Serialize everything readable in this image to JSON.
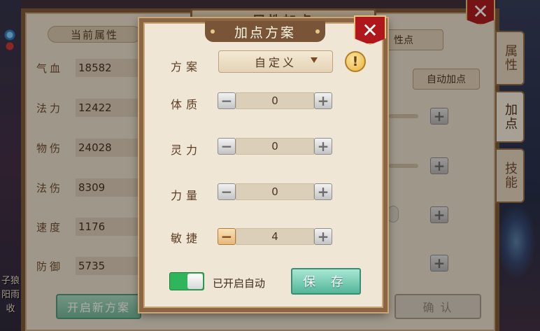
{
  "back_panel": {
    "title": "属性加点",
    "current_attr_tab": "当前属性",
    "attributes": [
      {
        "name": "气血",
        "value": "18582"
      },
      {
        "name": "法力",
        "value": "12422"
      },
      {
        "name": "物伤",
        "value": "24028"
      },
      {
        "name": "法伤",
        "value": "8309"
      },
      {
        "name": "速度",
        "value": "1176"
      },
      {
        "name": "防御",
        "value": "5735"
      }
    ],
    "partial_button": "性点",
    "auto_add_button": "自动加点",
    "side_tabs": [
      "属性",
      "加点",
      "技能"
    ],
    "new_scheme_button": "开启新方案",
    "confirm_button": "确 认",
    "scene_text": [
      "子狼",
      "阳雨",
      "收"
    ]
  },
  "modal": {
    "title": "加点方案",
    "scheme_label": "方案",
    "scheme_value": "自定义",
    "warning_glyph": "!",
    "stats": [
      {
        "label": "体质",
        "value": "0"
      },
      {
        "label": "灵力",
        "value": "0"
      },
      {
        "label": "力量",
        "value": "0"
      },
      {
        "label": "敏捷",
        "value": "4"
      }
    ],
    "toggle_on": true,
    "toggle_label": "已开启自动",
    "save_button": "保 存",
    "close_glyph": "✕"
  },
  "colors": {
    "panel_bg": "#e9e0cf",
    "frame": "#8c6644",
    "close_red": "#b0171d",
    "toggle_green": "#2fb65a",
    "save_teal": "#53b69a"
  }
}
